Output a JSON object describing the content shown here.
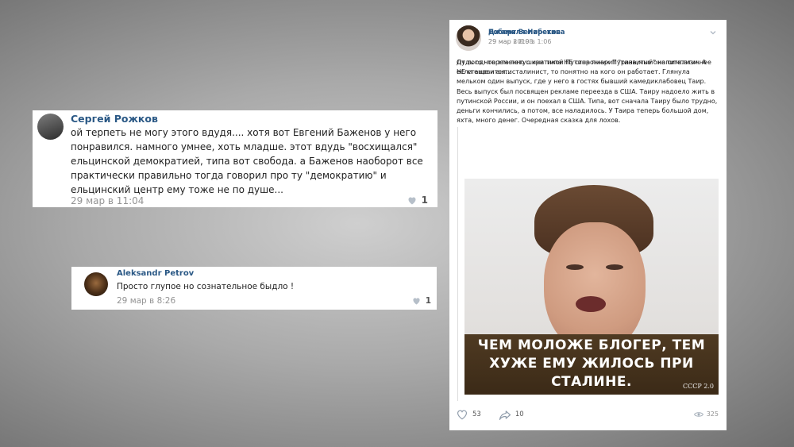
{
  "comment1": {
    "author": "Сергей Рожков",
    "text": "ой терпеть не могу этого вдудя.... хотя вот Евгений Баженов у него понравился. намного умнее, хоть младше. этот вдудь \"восхищался\" ельцинской демократией, типа вот свобода. а Баженов наоборот все практически правильно тогда говорил про ту \"демократию\" и ельцинский центр ему тоже не по душе...",
    "date": "29 мар в 11:04",
    "likes": "1"
  },
  "comment2": {
    "author": "Aleksandr Petrov",
    "text": "Просто глупое но сознательное быдло !",
    "date": "29 мар в 8:26",
    "likes": "1"
  },
  "post": {
    "author": "Джамиля Неретина",
    "date": "29 мар в 8:08",
    "text": "Дудь одновременно с критикой Путина пиарит \"развитый\" капитализм. А если еще и антисталинист, то понятно на кого он работает. Глянула мельком один выпуск, где у него в гостях бывший камедиклабовец Таир. Весь выпуск был посвящен рекламе переезда в США. Таиру надоело жить в путинской России, и он поехал в США. Типа, вот сначала Таиру было трудно, деньги кончились, а потом, все наладилось. У Таира теперь большой дом, яхта, много денег. Очередная сказка для лохов.",
    "repost": {
      "author": "Роберт Велибеков",
      "date": "29 мар 2019 в 1:06",
      "text": "От того что эта петушина типа НЕ сторонник Путина,мне оно симпатичнее НЕ становится...",
      "image": {
        "caption_line1": "ЧЕМ МОЛОЖЕ БЛОГЕР, ТЕМ",
        "caption_line2": "ХУЖЕ ЕМУ ЖИЛОСЬ ПРИ",
        "caption_line3": "СТАЛИНЕ.",
        "watermark": "СССР 2.0"
      }
    },
    "likes": "53",
    "shares": "10",
    "views": "325"
  },
  "colors": {
    "link": "#2a5885",
    "muted": "#939393",
    "banner": "#4a3520"
  }
}
